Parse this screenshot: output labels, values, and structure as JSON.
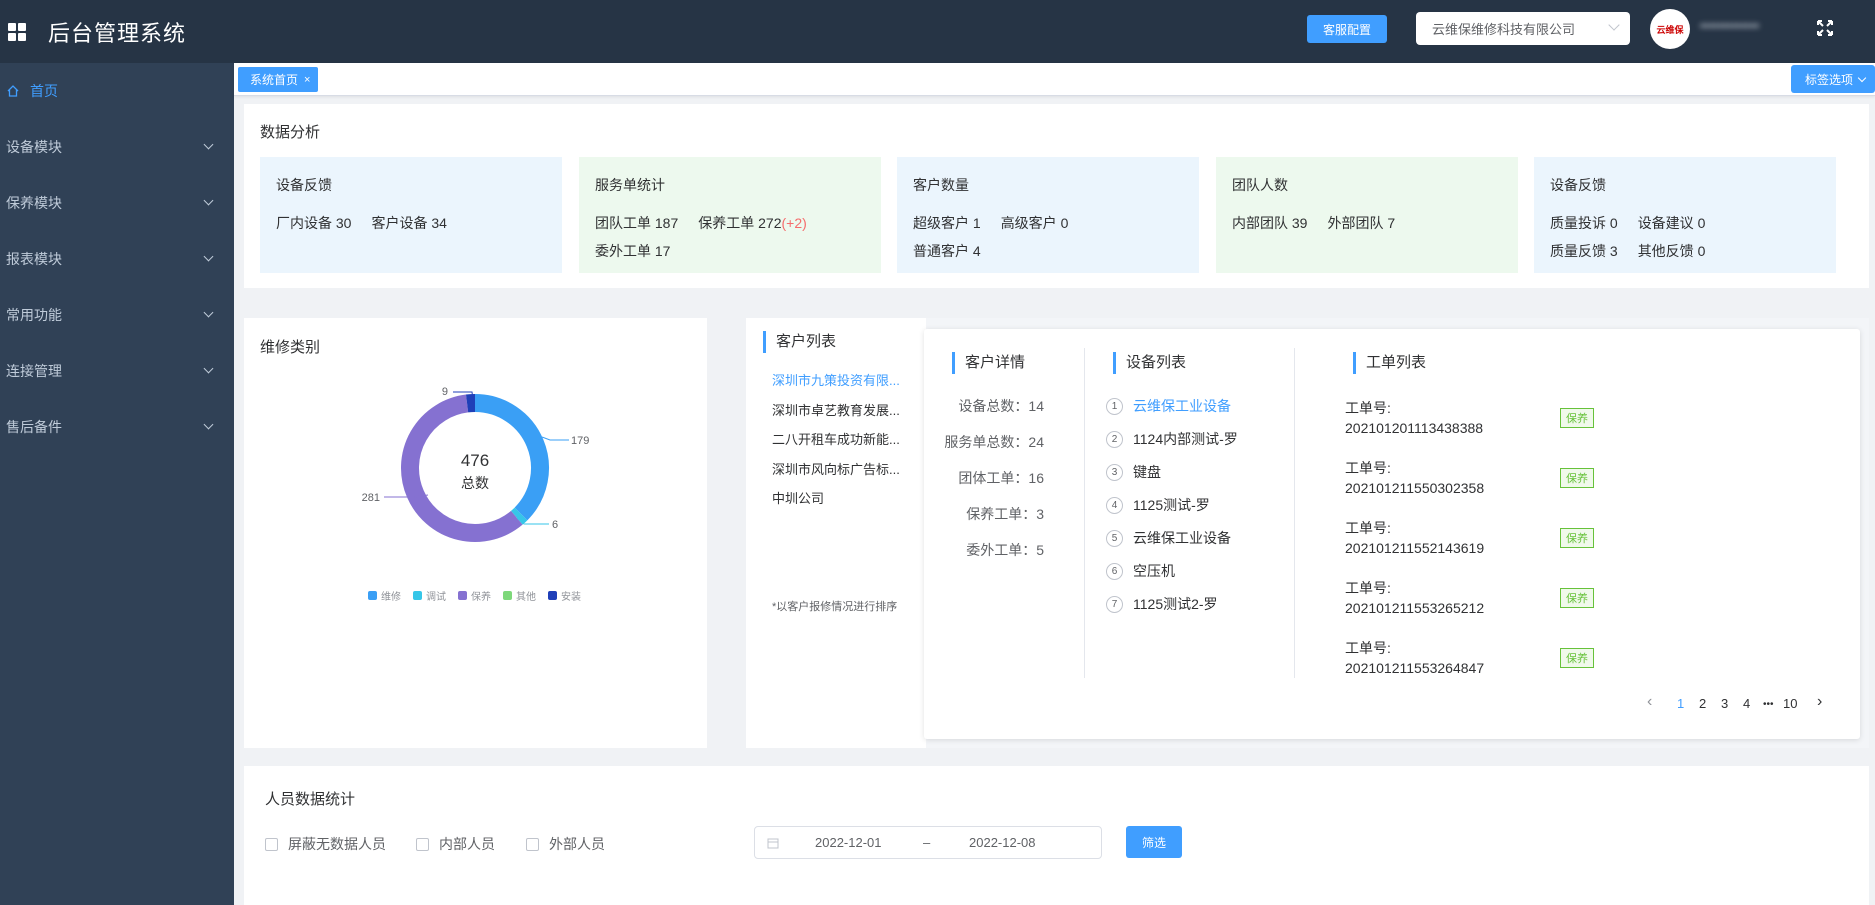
{
  "header": {
    "title": "后台管理系统",
    "service_button": "客服配置",
    "company": "云维保维修科技有限公司",
    "logo_text": "云维保",
    "user_name": "•••••••••••••"
  },
  "sidebar": {
    "items": [
      {
        "label": "首页"
      },
      {
        "label": "设备模块"
      },
      {
        "label": "保养模块"
      },
      {
        "label": "报表模块"
      },
      {
        "label": "常用功能"
      },
      {
        "label": "连接管理"
      },
      {
        "label": "售后备件"
      }
    ]
  },
  "tags": {
    "current": "系统首页",
    "close": "×",
    "options": "标签选项"
  },
  "analysis": {
    "title": "数据分析",
    "boxes": [
      {
        "title": "设备反馈",
        "l1": "厂内设备  30",
        "l2": "客户设备  34",
        "l3": "",
        "l4": ""
      },
      {
        "title": "服务单统计",
        "l1": "团队工单  187",
        "l2": "保养工单  272",
        "plus": "(+2)",
        "l3": "委外工单  17",
        "l4": ""
      },
      {
        "title": "客户数量",
        "l1": "超级客户  1",
        "l2": "高级客户  0",
        "l3": "普通客户  4",
        "l4": ""
      },
      {
        "title": "团队人数",
        "l1": "内部团队  39",
        "l2": "外部团队  7",
        "l3": "",
        "l4": ""
      },
      {
        "title": "设备反馈",
        "l1": "质量投诉  0",
        "l2": "设备建议  0",
        "l3": "质量反馈  3",
        "l4": "其他反馈  0"
      }
    ]
  },
  "repair": {
    "title": "维修类别",
    "total": "476",
    "total_label": "总数",
    "labels": {
      "a": "9",
      "b": "179",
      "c": "281",
      "d": "6"
    },
    "legend": [
      "维修",
      "调试",
      "保养",
      "其他",
      "安装"
    ],
    "colors": [
      "#3a9ff5",
      "#36c6e8",
      "#8571d1",
      "#7dd87a",
      "#1f3fb8"
    ]
  },
  "customers": {
    "title": "客户列表",
    "items": [
      "深圳市九策投资有限...",
      "深圳市卓艺教育发展...",
      "二八开租车成功新能...",
      "深圳市风向标广告标...",
      "中圳公司"
    ],
    "note": "*以客户报修情况进行排序"
  },
  "detail": {
    "title": "客户详情",
    "rows": [
      "设备总数：14",
      "服务单总数：24",
      "团体工单：16",
      "保养工单：3",
      "委外工单：5"
    ]
  },
  "devices": {
    "title": "设备列表",
    "items": [
      "云维保工业设备",
      "1124内部测试-罗",
      "键盘",
      "1125测试-罗",
      "云维保工业设备",
      "空压机",
      "1125测试2-罗"
    ]
  },
  "workorders": {
    "title": "工单列表",
    "label": "工单号:",
    "tag": "保养",
    "items": [
      "202101201113438388",
      "202101211550302358",
      "202101211552143619",
      "202101211553265212",
      "202101211553264847"
    ]
  },
  "pager": {
    "p1": "1",
    "p2": "2",
    "p3": "3",
    "p4": "4",
    "dots": "•••",
    "p10": "10",
    "prev": "‹",
    "next": "›"
  },
  "people": {
    "title": "人员数据统计",
    "check1": "屏蔽无数据人员",
    "check2": "内部人员",
    "check3": "外部人员",
    "date_start": "2022-12-01",
    "date_sep": "–",
    "date_end": "2022-12-08",
    "filter": "筛选"
  }
}
